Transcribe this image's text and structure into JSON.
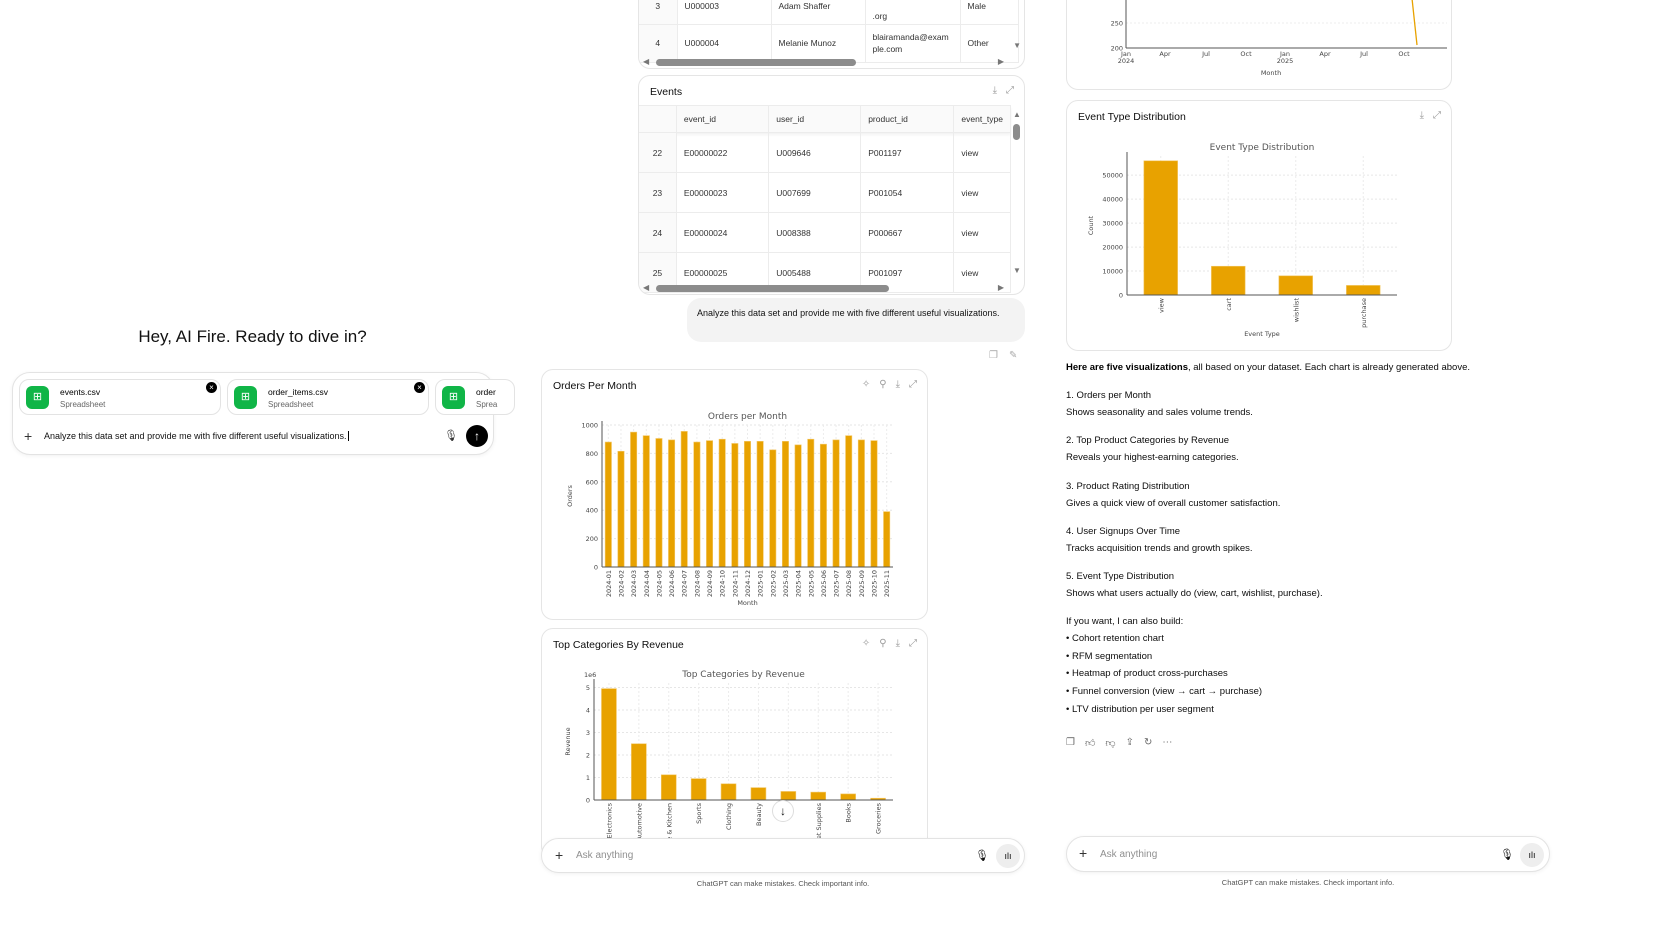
{
  "left": {
    "greeting": "Hey, AI Fire. Ready to dive in?",
    "attachments": [
      {
        "name": "events.csv",
        "type": "Spreadsheet"
      },
      {
        "name": "order_items.csv",
        "type": "Spreadsheet"
      },
      {
        "name": "order",
        "type": "Sprea"
      }
    ],
    "input_value": "Analyze this data set and provide me with five different useful visualizations.",
    "plus": "+"
  },
  "users_table": {
    "rows": [
      [
        "3",
        "U000003",
        "Adam Shaffer",
        ".org",
        "Male"
      ],
      [
        "4",
        "U000004",
        "Melanie Munoz",
        "blairamanda@example.com",
        "Other"
      ]
    ]
  },
  "events_table": {
    "title": "Events",
    "columns": [
      "",
      "event_id",
      "user_id",
      "product_id",
      "event_type"
    ],
    "rows": [
      [
        "22",
        "E00000022",
        "U009646",
        "P001197",
        "view"
      ],
      [
        "23",
        "E00000023",
        "U007699",
        "P001054",
        "view"
      ],
      [
        "24",
        "E00000024",
        "U008388",
        "P000667",
        "view"
      ],
      [
        "25",
        "E00000025",
        "U005488",
        "P001097",
        "view"
      ]
    ]
  },
  "user_message": "Analyze this data set and provide me with five different useful visualizations.",
  "cards": {
    "orders": "Orders Per Month",
    "categories": "Top Categories By Revenue",
    "events": "Event Type Distribution"
  },
  "chart_data": [
    {
      "type": "bar",
      "title": "Orders per Month",
      "xlabel": "Month",
      "ylabel": "Orders",
      "ylim": [
        0,
        1000
      ],
      "yticks": [
        0,
        200,
        400,
        600,
        800,
        1000
      ],
      "grid": true,
      "color": "#e8a200",
      "categories": [
        "2024-01",
        "2024-02",
        "2024-03",
        "2024-04",
        "2024-05",
        "2024-06",
        "2024-07",
        "2024-08",
        "2024-09",
        "2024-10",
        "2024-11",
        "2024-12",
        "2025-01",
        "2025-02",
        "2025-03",
        "2025-04",
        "2025-05",
        "2025-06",
        "2025-07",
        "2025-08",
        "2025-09",
        "2025-10",
        "2025-11"
      ],
      "values": [
        880,
        815,
        950,
        925,
        905,
        895,
        955,
        880,
        890,
        900,
        870,
        885,
        885,
        825,
        885,
        860,
        900,
        865,
        895,
        925,
        895,
        890,
        390
      ]
    },
    {
      "type": "bar",
      "title": "Top Categories by Revenue",
      "ylabel": "Revenue",
      "yscale_label": "1e6",
      "ylim": [
        0,
        5.2
      ],
      "yticks": [
        0,
        1,
        2,
        3,
        4,
        5
      ],
      "grid": true,
      "color": "#e8a200",
      "categories": [
        "Electronics",
        "Automotive",
        "Home & Kitchen",
        "Sports",
        "Clothing",
        "Beauty",
        "Toys",
        "Pet Supplies",
        "Books",
        "Groceries"
      ],
      "values": [
        4.95,
        2.5,
        1.12,
        0.95,
        0.72,
        0.55,
        0.38,
        0.35,
        0.27,
        0.08
      ]
    },
    {
      "type": "bar",
      "title": "Event Type Distribution",
      "xlabel": "Event Type",
      "ylabel": "Count",
      "ylim": [
        0,
        58000
      ],
      "yticks": [
        0,
        10000,
        20000,
        30000,
        40000,
        50000
      ],
      "grid": true,
      "color": "#e8a200",
      "categories": [
        "view",
        "cart",
        "wishlist",
        "purchase"
      ],
      "values": [
        56000,
        12000,
        8000,
        4000
      ]
    },
    {
      "type": "line",
      "xlabel": "Month",
      "yticks": [
        200,
        250
      ],
      "xticks": [
        "Jan\n2024",
        "Apr",
        "Jul",
        "Oct",
        "Jan\n2025",
        "Apr",
        "Jul",
        "Oct"
      ],
      "color": "#e8a200",
      "x": [
        "2025-10",
        "2025-11"
      ],
      "y": [
        300,
        205
      ]
    }
  ],
  "response": {
    "intro_bold": "Here are five visualizations",
    "intro_rest": ", all based on your dataset. Each chart is already generated above.",
    "items": [
      {
        "title": "1. Orders per Month",
        "desc": "Shows seasonality and sales volume trends."
      },
      {
        "title": "2. Top Product Categories by Revenue",
        "desc": "Reveals your highest-earning categories."
      },
      {
        "title": "3. Product Rating Distribution",
        "desc": "Gives a quick view of overall customer satisfaction."
      },
      {
        "title": "4. User Signups Over Time",
        "desc": "Tracks acquisition trends and growth spikes."
      },
      {
        "title": "5. Event Type Distribution",
        "desc": "Shows what users actually do (view, cart, wishlist, purchase)."
      }
    ],
    "offer": "If you want, I can also build:",
    "bullets": [
      "• Cohort retention chart",
      "• RFM segmentation",
      "• Heatmap of product cross-purchases",
      "• Funnel conversion (view → cart → purchase)",
      "• LTV distribution per user segment"
    ]
  },
  "composer": {
    "placeholder": "Ask anything",
    "footer": "ChatGPT can make mistakes. Check important info."
  },
  "colors": {
    "accent": "#e8a200",
    "spreadsheet": "#10b547"
  }
}
